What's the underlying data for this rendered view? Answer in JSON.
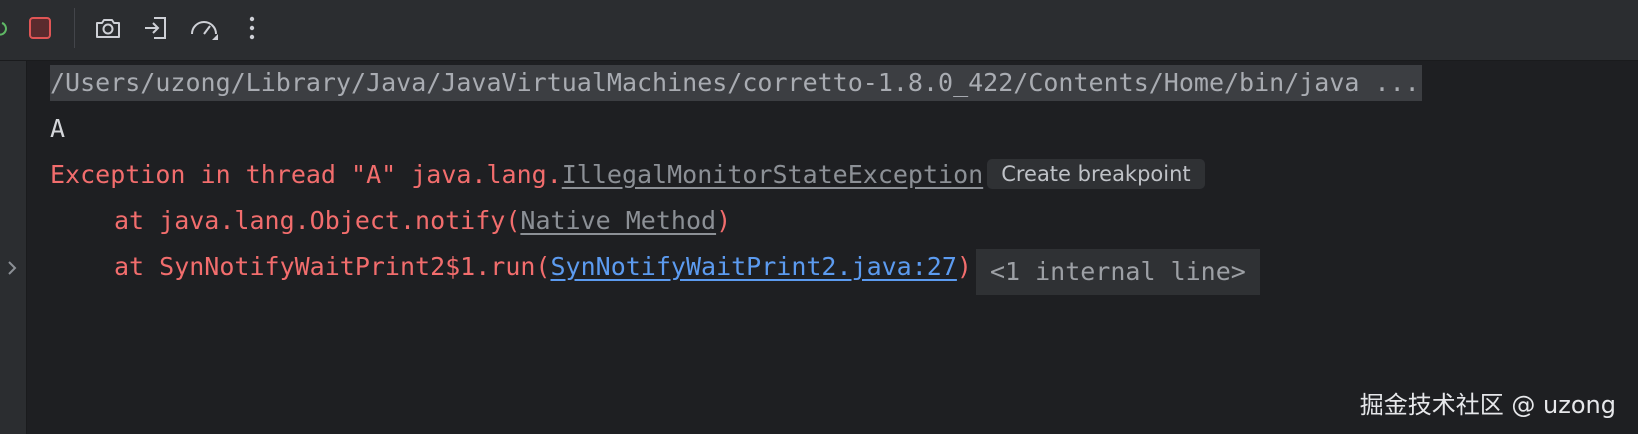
{
  "toolbar": {
    "icons": [
      "rerun-icon",
      "stop-icon",
      "screenshot-icon",
      "restore-layout-icon",
      "profiler-icon",
      "more-icon"
    ]
  },
  "console": {
    "command_line": "/Users/uzong/Library/Java/JavaVirtualMachines/corretto-1.8.0_422/Contents/Home/bin/java ...",
    "output_line": "A",
    "exception": {
      "prefix": "Exception in thread \"A\" java.lang.",
      "class_link": "IllegalMonitorStateException",
      "breakpoint_button": "Create breakpoint"
    },
    "stack": [
      {
        "prefix": "at java.lang.Object.notify(",
        "link": "Native Method",
        "suffix": ")"
      },
      {
        "prefix": "at SynNotifyWaitPrint2$1.run(",
        "link": "SynNotifyWaitPrint2.java:27",
        "suffix": ")",
        "folded": "<1 internal line>"
      }
    ]
  },
  "watermark": "掘金技术社区 @ uzong",
  "colors": {
    "background": "#1e1f22",
    "error_text": "#f26d6d",
    "link_blue": "#5c9bf0",
    "stop_red": "#e05555"
  }
}
